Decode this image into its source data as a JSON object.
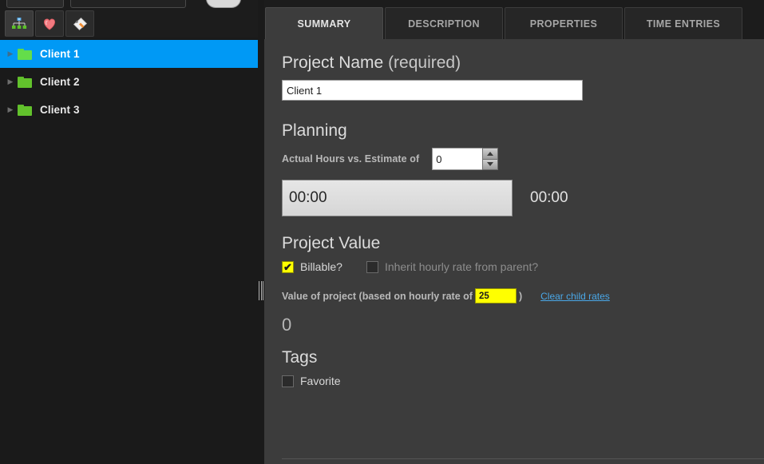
{
  "sidebar": {
    "toolbar": [
      {
        "name": "hierarchy-icon",
        "label": "Hierarchy",
        "active": true
      },
      {
        "name": "favorites-heart-icon",
        "label": "Favorites",
        "active": false
      },
      {
        "name": "tags-icon",
        "label": "Tags",
        "active": false
      }
    ],
    "tree": [
      {
        "label": "Client 1",
        "expander": "▶",
        "selected": true
      },
      {
        "label": "Client 2",
        "expander": "▶",
        "selected": false
      },
      {
        "label": "Client 3",
        "expander": "▶",
        "selected": false
      }
    ]
  },
  "main": {
    "tabs": [
      {
        "label": "SUMMARY",
        "active": true
      },
      {
        "label": "DESCRIPTION",
        "active": false
      },
      {
        "label": "PROPERTIES",
        "active": false
      },
      {
        "label": "TIME ENTRIES",
        "active": false
      }
    ],
    "project_name": {
      "heading": "Project Name",
      "heading_suffix": "(required)",
      "value": "Client 1",
      "placeholder": ""
    },
    "planning": {
      "heading": "Planning",
      "estimate_label": "Actual Hours vs. Estimate of",
      "estimate_value": "0",
      "actual_hours": "00:00",
      "estimate_total": "00:00",
      "progress_percent": 0
    },
    "project_value": {
      "heading": "Project Value",
      "billable_label": "Billable?",
      "billable_checked": true,
      "inherit_label": "Inherit hourly rate from parent?",
      "inherit_checked": false,
      "value_prefix": "Value of project (based on hourly rate of",
      "rate_value": "25",
      "value_suffix": ")",
      "clear_child_rates_link": "Clear child rates",
      "computed_value": "0"
    },
    "tags": {
      "heading": "Tags",
      "items": [
        {
          "label": "Favorite",
          "checked": false
        }
      ]
    }
  },
  "colors": {
    "selection_blue": "#0099f5",
    "folder_green": "#62c22c",
    "highlight_yellow": "#ffff00",
    "link_blue": "#4aa8e8",
    "panel_bg": "#3c3c3c",
    "sidebar_bg": "#1a1a1a",
    "heart_pink": "#f2797f"
  }
}
